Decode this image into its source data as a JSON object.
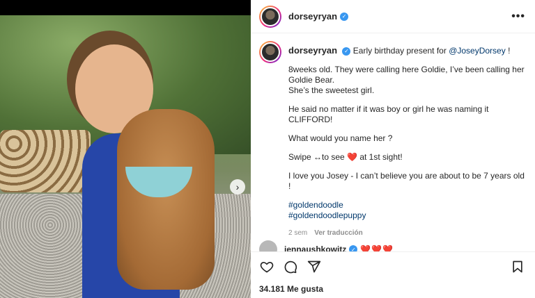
{
  "post": {
    "username": "dorseyryan",
    "verified_badge": "✓",
    "more_label": "•••"
  },
  "caption": {
    "username": "dorseyryan",
    "intro": "Early birthday present for ",
    "mention": "@JoseyDorsey",
    "intro_end": " !",
    "paragraphs": [
      "8weeks old. They were calling here Goldie, I’ve been calling her Goldie Bear.\nShe’s the sweetest girl.",
      "He said no matter if it was boy or girl he was naming it CLIFFORD!",
      "What would you name her ?",
      "Swipe ↔to see ❤️ at 1st sight!",
      "I love you Josey - I can’t believe you are about to be 7 years old !"
    ],
    "hashtags": [
      "#goldendoodle",
      "#goldendoodlepuppy"
    ],
    "time": "2 sem",
    "see_translation": "Ver traducción"
  },
  "comment": {
    "username": "jennaushkowitz",
    "hearts": "❤️❤️❤️"
  },
  "actions": {
    "likes": "34.181 Me gusta"
  },
  "icons": {
    "next": "chevron-right-icon",
    "like": "heart-icon",
    "comment": "comment-icon",
    "share": "share-icon",
    "save": "bookmark-icon"
  },
  "colors": {
    "link": "#00376b",
    "verified": "#3897f0",
    "heart": "#ed4956",
    "muted": "#8e8e8e"
  }
}
